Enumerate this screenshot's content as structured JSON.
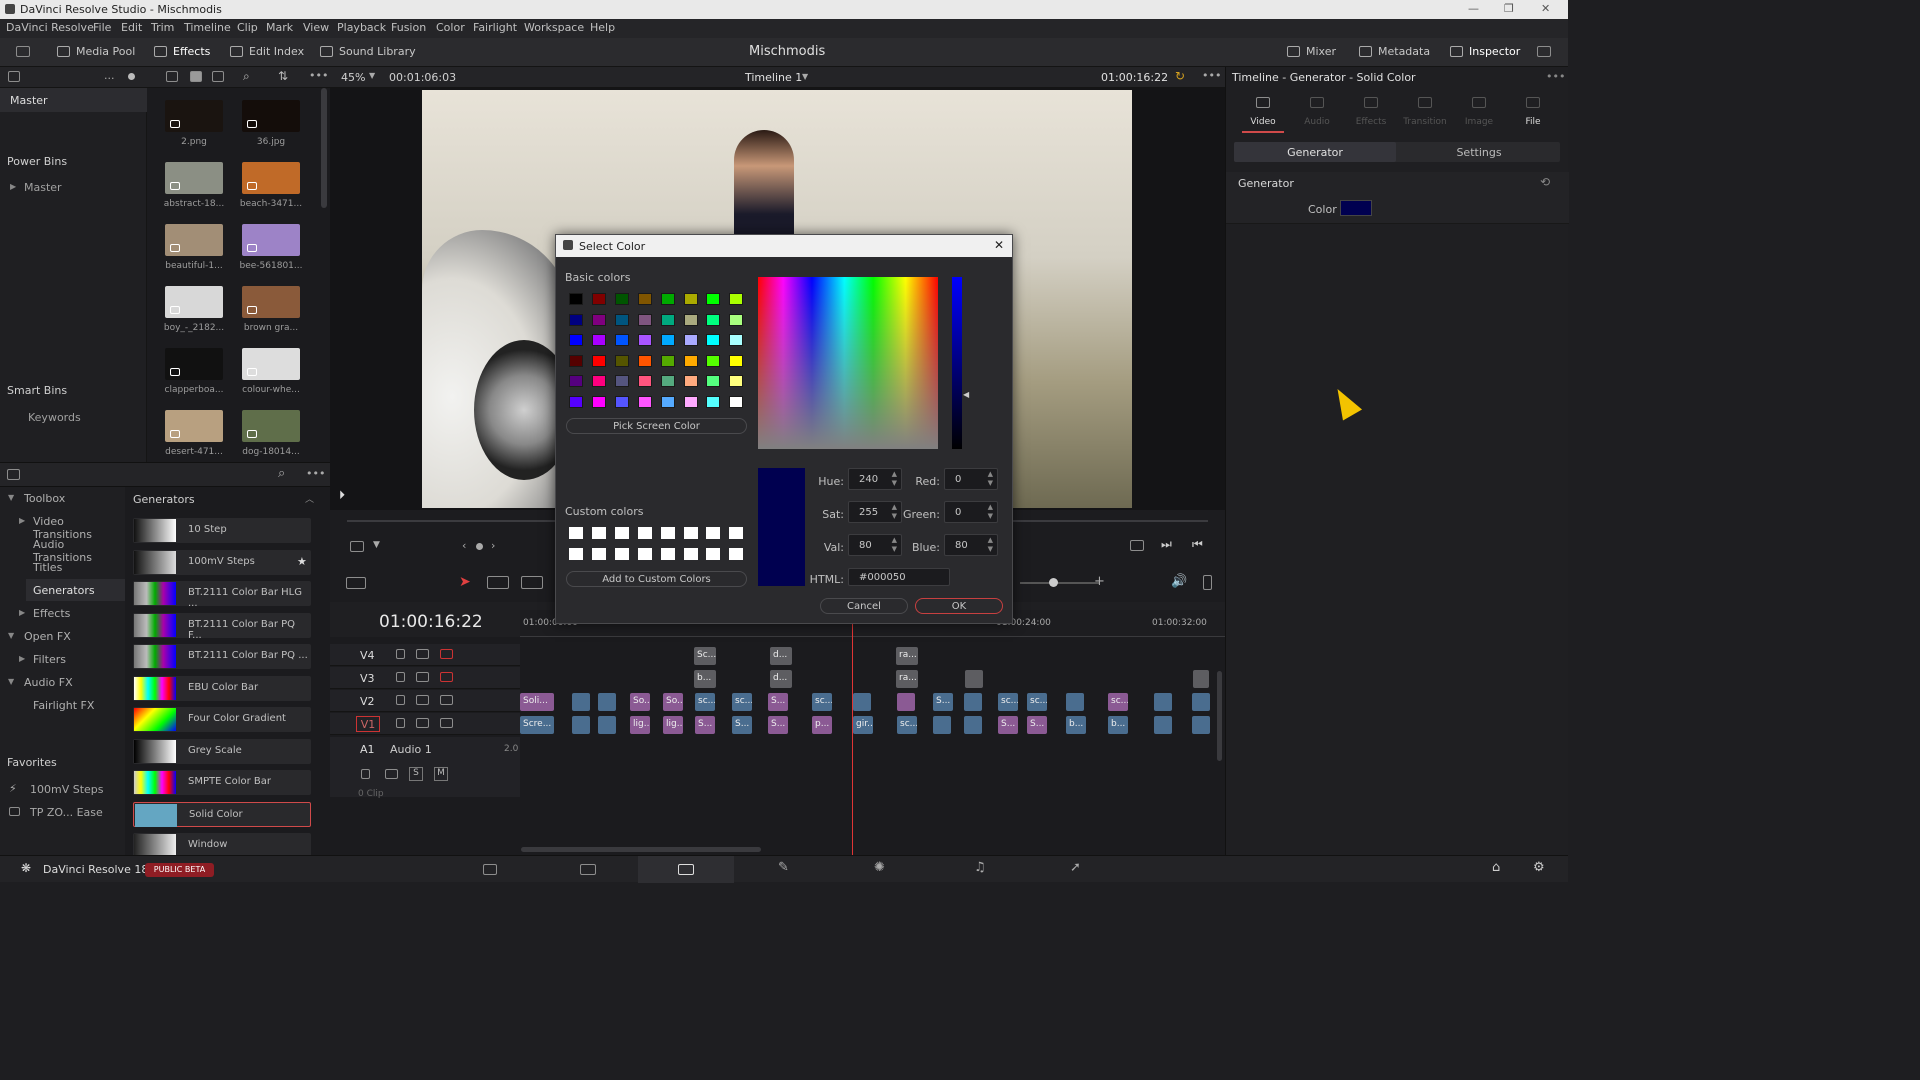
{
  "window": {
    "title": "DaVinci Resolve Studio - Mischmodis"
  },
  "menu": [
    "DaVinci Resolve",
    "File",
    "Edit",
    "Trim",
    "Timeline",
    "Clip",
    "Mark",
    "View",
    "Playback",
    "Fusion",
    "Color",
    "Fairlight",
    "Workspace",
    "Help"
  ],
  "toolbar": {
    "media_pool": "Media Pool",
    "effects": "Effects",
    "edit_index": "Edit Index",
    "sound_library": "Sound Library",
    "project": "Mischmodis",
    "mixer": "Mixer",
    "metadata": "Metadata",
    "inspector": "Inspector"
  },
  "subbar": {
    "zoom": "45%",
    "duration": "00:01:06:03",
    "timeline": "Timeline 1",
    "timecode": "01:00:16:22"
  },
  "bins": {
    "master": "Master",
    "power_bins": "Power Bins",
    "power_master": "Master",
    "smart_bins": "Smart Bins",
    "keywords": "Keywords"
  },
  "media": [
    {
      "label": "2.png",
      "color": "#1a1410"
    },
    {
      "label": "36.jpg",
      "color": "#140d0a"
    },
    {
      "label": "abstract-18...",
      "color": "#8b8f84"
    },
    {
      "label": "beach-3471...",
      "color": "#c06a28"
    },
    {
      "label": "beautiful-1...",
      "color": "#a28e76"
    },
    {
      "label": "bee-561801...",
      "color": "#9d83c7"
    },
    {
      "label": "boy_-_2182...",
      "color": "#d8d8d8"
    },
    {
      "label": "brown gra...",
      "color": "#8a5a3a"
    },
    {
      "label": "clapperboa...",
      "color": "#111111"
    },
    {
      "label": "colour-whe...",
      "color": "#dddddd"
    },
    {
      "label": "desert-471...",
      "color": "#b8a080"
    },
    {
      "label": "dog-18014...",
      "color": "#5f6e4a"
    }
  ],
  "fxtree": {
    "toolbox": "Toolbox",
    "video_transitions": "Video Transitions",
    "audio_transitions": "Audio Transitions",
    "titles": "Titles",
    "generators": "Generators",
    "effects": "Effects",
    "open_fx": "Open FX",
    "filters": "Filters",
    "audio_fx": "Audio FX",
    "fairlight_fx": "Fairlight FX"
  },
  "generators": {
    "title": "Generators",
    "items": [
      "10 Step",
      "100mV Steps",
      "BT.2111 Color Bar HLG ...",
      "BT.2111 Color Bar PQ F...",
      "BT.2111 Color Bar PQ ...",
      "EBU Color Bar",
      "Four Color Gradient",
      "Grey Scale",
      "SMPTE Color Bar",
      "Solid Color",
      "Window"
    ]
  },
  "favorites": {
    "title": "Favorites",
    "item1": "100mV Steps",
    "item2": "TP ZO... Ease"
  },
  "timeline": {
    "timecode": "01:00:16:22",
    "ruler": [
      "01:00:00:00",
      "01:00:24:00",
      "01:00:32:00"
    ],
    "tracks": [
      "V4",
      "V3",
      "V2",
      "V1"
    ],
    "audio": {
      "id": "A1",
      "name": "Audio 1",
      "level": "2.0",
      "clip": "0 Clip"
    },
    "btn_s": "S",
    "btn_m": "M"
  },
  "clips": {
    "v4": [
      "Sc...",
      "d...",
      "ra..."
    ],
    "v3": [
      "b...",
      "d...",
      "ra..."
    ],
    "v2": [
      "Soli...",
      "So...",
      "So...",
      "sc...",
      "sc...",
      "S...",
      "sc...",
      "S...",
      "sc...",
      "sc...",
      "sc...",
      "sc...",
      "S..."
    ],
    "v1": [
      "Scre...",
      "lig...",
      "lig...",
      "S...",
      "S...",
      "S...",
      "p...",
      "gir...",
      "sc...",
      "S...",
      "S...",
      "b...",
      "b..."
    ]
  },
  "inspector": {
    "title": "Timeline - Generator - Solid Color",
    "tabs": [
      "Video",
      "Audio",
      "Effects",
      "Transition",
      "Image",
      "File"
    ],
    "sub_tabs": [
      "Generator",
      "Settings"
    ],
    "section": "Generator",
    "color_label": "Color",
    "color_value": "#000050"
  },
  "dialog": {
    "title": "Select Color",
    "basic_colors_label": "Basic colors",
    "basic_colors": [
      "#000000",
      "#800000",
      "#005500",
      "#805500",
      "#00aa00",
      "#aaaa00",
      "#00ff00",
      "#aaff00",
      "#00007f",
      "#7f007f",
      "#00557f",
      "#7f557f",
      "#00aa7f",
      "#aaaa7f",
      "#00ff7f",
      "#aaff7f",
      "#0000ff",
      "#aa00ff",
      "#0055ff",
      "#aa55ff",
      "#00aaff",
      "#aaaaff",
      "#00ffff",
      "#aaffff",
      "#550000",
      "#ff0000",
      "#555500",
      "#ff5500",
      "#55aa00",
      "#ffaa00",
      "#55ff00",
      "#ffff00",
      "#55007f",
      "#ff007f",
      "#55557f",
      "#ff557f",
      "#55aa7f",
      "#ffaa7f",
      "#55ff7f",
      "#ffff7f",
      "#5500ff",
      "#ff00ff",
      "#5555ff",
      "#ff55ff",
      "#55aaff",
      "#ffaaff",
      "#55ffff",
      "#ffffff"
    ],
    "pick_screen": "Pick Screen Color",
    "custom_colors_label": "Custom colors",
    "add_custom": "Add to Custom Colors",
    "hue_label": "Hue:",
    "hue": "240",
    "sat_label": "Sat:",
    "sat": "255",
    "val_label": "Val:",
    "val": "80",
    "red_label": "Red:",
    "red": "0",
    "green_label": "Green:",
    "green": "0",
    "blue_label": "Blue:",
    "blue": "80",
    "html_label": "HTML:",
    "html": "#000050",
    "cancel": "Cancel",
    "ok": "OK",
    "current_color": "#000050"
  },
  "bottom": {
    "app": "DaVinci Resolve 18",
    "badge": "PUBLIC BETA"
  }
}
